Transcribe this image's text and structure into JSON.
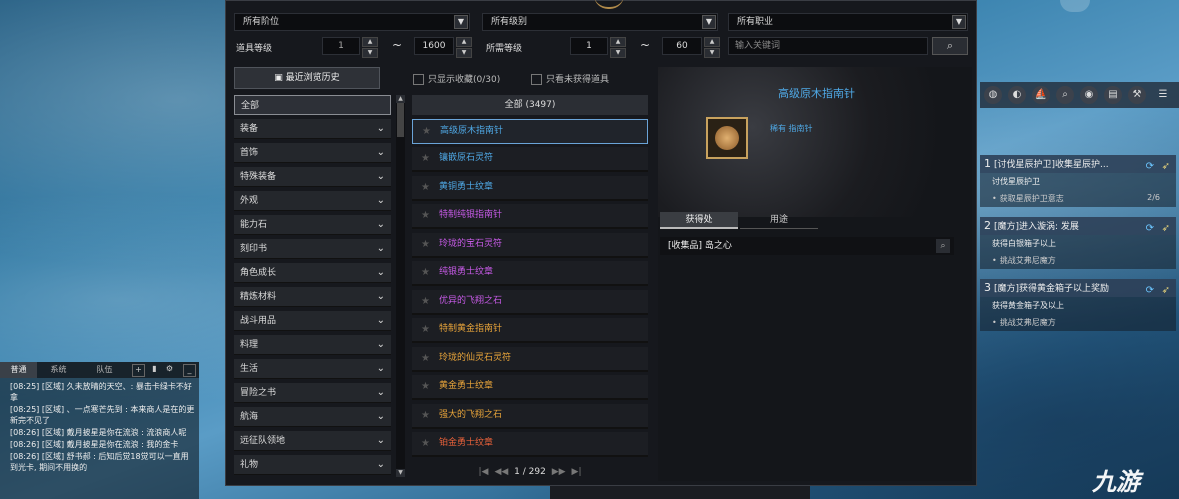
{
  "filters": {
    "tier": "所有阶位",
    "grade": "所有级别",
    "class": "所有职业",
    "item_level_label": "道具等级",
    "item_level_min": "1",
    "item_level_max": "1600",
    "required_level_label": "所需等级",
    "required_level_min": "1",
    "required_level_max": "60",
    "range_sep": "~",
    "keyword_placeholder": "输入关键词"
  },
  "history_button": "最近浏览历史",
  "checkboxes": {
    "favorites": "只显示收藏(0/30)",
    "unobtained": "只看未获得道具"
  },
  "categories": [
    {
      "label": "全部"
    },
    {
      "label": "装备"
    },
    {
      "label": "首饰"
    },
    {
      "label": "特殊装备"
    },
    {
      "label": "外观"
    },
    {
      "label": "能力石"
    },
    {
      "label": "刻印书"
    },
    {
      "label": "角色成长"
    },
    {
      "label": "精炼材料"
    },
    {
      "label": "战斗用品"
    },
    {
      "label": "料理"
    },
    {
      "label": "生活"
    },
    {
      "label": "冒险之书"
    },
    {
      "label": "航海"
    },
    {
      "label": "远征队领地"
    },
    {
      "label": "礼物"
    }
  ],
  "list": {
    "header": "全部 (3497)",
    "items": [
      {
        "name": "高级原木指南针",
        "color": "#4fa9e6"
      },
      {
        "name": "镶嵌原石灵符",
        "color": "#4fa9e6"
      },
      {
        "name": "黄铜勇士纹章",
        "color": "#4fa9e6"
      },
      {
        "name": "特制纯银指南针",
        "color": "#c65ae6"
      },
      {
        "name": "玲珑的宝石灵符",
        "color": "#c65ae6"
      },
      {
        "name": "纯银勇士纹章",
        "color": "#c65ae6"
      },
      {
        "name": "优异的飞翔之石",
        "color": "#c65ae6"
      },
      {
        "name": "特制黄金指南针",
        "color": "#e8a43a"
      },
      {
        "name": "玲珑的仙灵石灵符",
        "color": "#e8a43a"
      },
      {
        "name": "黄金勇士纹章",
        "color": "#e8a43a"
      },
      {
        "name": "强大的飞翔之石",
        "color": "#e8a43a"
      },
      {
        "name": "铂金勇士纹章",
        "color": "#e8613a"
      }
    ],
    "page": "1 / 292"
  },
  "detail": {
    "title": "高级原木指南针",
    "rarity": "稀有 指南针",
    "tab_source": "获得处",
    "tab_usage": "用途",
    "source": "[收集品] 岛之心"
  },
  "quests": [
    {
      "num": "1",
      "title": "[讨伐星辰护卫]收集星辰护...",
      "goal": "讨伐星辰护卫",
      "sub": "获取星辰护卫意志",
      "count": "2/6"
    },
    {
      "num": "2",
      "title": "[魔方]进入漩涡: 发展",
      "goal": "获得白银箱子以上",
      "sub": "挑战艾弗尼魔方",
      "count": ""
    },
    {
      "num": "3",
      "title": "[魔方]获得黄金箱子以上奖励",
      "goal": "获得黄金箱子及以上",
      "sub": "挑战艾弗尼魔方",
      "count": ""
    }
  ],
  "chat": {
    "tabs": [
      "普通",
      "系统",
      "队伍"
    ],
    "lines": [
      "[08:25] [区域] 久未放晴的天空、: 暴击卡绿卡不好拿",
      "[08:25] [区域] 、一点寒芒先到 : 本来商人是在的更新完不见了",
      "[08:26] [区域] 戴月披星是你在流浪 : 流浪商人呢",
      "[08:26] [区域] 戴月披星是你在流浪 : 我的金卡",
      "[08:26] [区域] 舒书郝 : 后知后觉18觉可以一直用到光卡, 期间不用换的"
    ]
  },
  "watermark": "九游",
  "icons": [
    "dropdown-arrow",
    "spinner-up",
    "spinner-down",
    "search-icon",
    "history-icon",
    "chevron-down-icon",
    "star-icon",
    "pager-first",
    "pager-prev",
    "pager-next",
    "pager-last",
    "magnifier-icon",
    "quest-refresh-icon",
    "quest-pin-icon"
  ]
}
